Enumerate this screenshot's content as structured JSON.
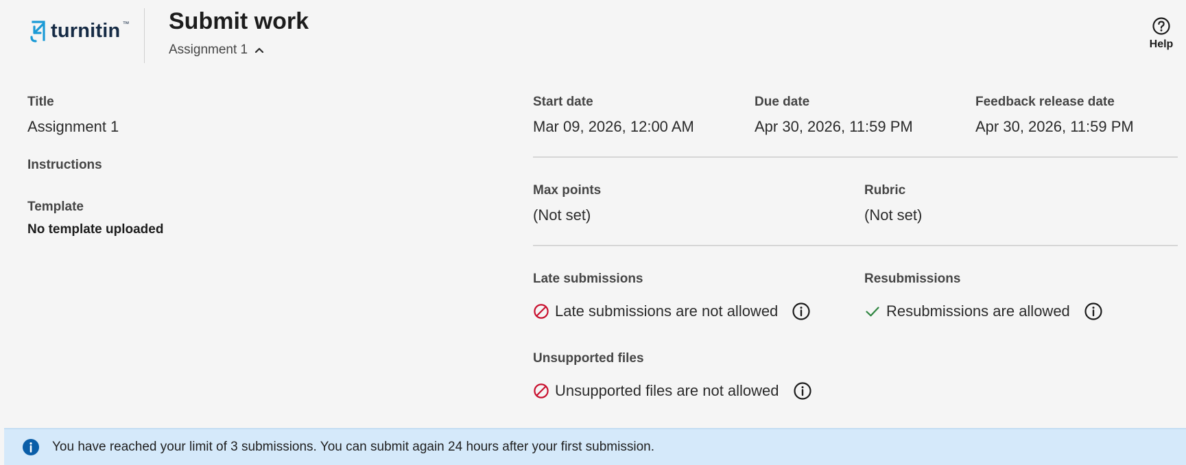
{
  "header": {
    "logo_text": "turnitin",
    "logo_tm": "™",
    "title": "Submit work",
    "assignment_selector": "Assignment 1",
    "help_label": "Help"
  },
  "details": {
    "title_label": "Title",
    "title_value": "Assignment 1",
    "instructions_label": "Instructions",
    "template_label": "Template",
    "template_value": "No template uploaded"
  },
  "dates": {
    "start_label": "Start date",
    "start_value": "Mar 09, 2026, 12:00 AM",
    "due_label": "Due date",
    "due_value": "Apr 30, 2026, 11:59 PM",
    "feedback_label": "Feedback release date",
    "feedback_value": "Apr 30, 2026, 11:59 PM"
  },
  "grading": {
    "max_points_label": "Max points",
    "max_points_value": "(Not set)",
    "rubric_label": "Rubric",
    "rubric_value": "(Not set)"
  },
  "policies": {
    "late_label": "Late submissions",
    "late_value": "Late submissions are not allowed",
    "resub_label": "Resubmissions",
    "resub_value": "Resubmissions are allowed",
    "unsupported_label": "Unsupported files",
    "unsupported_value": "Unsupported files are not allowed"
  },
  "banner": {
    "message": "You have reached your limit of 3 submissions. You can submit again 24 hours after your first submission."
  },
  "icons": {
    "not_allowed": "prohibited-icon",
    "allowed": "checkmark-icon",
    "info": "info-icon",
    "help": "help-circle-icon",
    "chevron": "chevron-up-icon"
  },
  "colors": {
    "not_allowed": "#c8102e",
    "allowed": "#2e8540",
    "banner_bg": "#d5e9fa",
    "banner_icon": "#0a5ea8",
    "logo_blue": "#1a9ad6",
    "logo_text": "#162b45"
  }
}
